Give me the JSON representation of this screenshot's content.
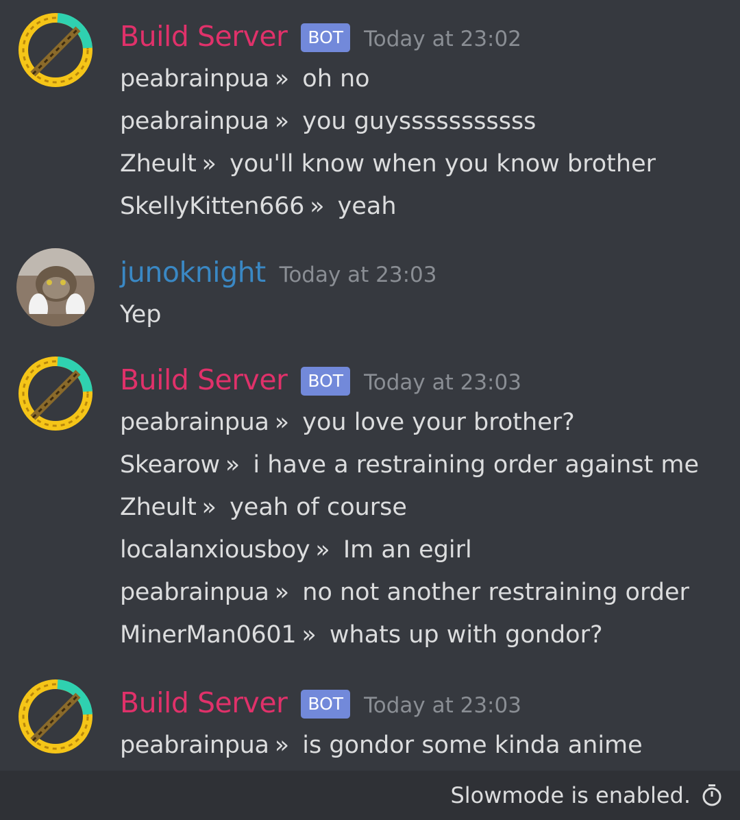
{
  "messages": [
    {
      "author": "Build Server",
      "bot_tag": "BOT",
      "timestamp": "Today at 23:02",
      "lines": [
        {
          "sender": "peabrainpua",
          "sep": "»",
          "text": "oh no"
        },
        {
          "sender": "peabrainpua",
          "sep": "»",
          "text": "you guysssssssssss"
        },
        {
          "sender": "Zheult",
          "sep": "»",
          "text": "you'll know when you know brother"
        },
        {
          "sender": "SkellyKitten666",
          "sep": "»",
          "text": "yeah"
        }
      ]
    },
    {
      "author": "junoknight",
      "timestamp": "Today at 23:03",
      "text": "Yep"
    },
    {
      "author": "Build Server",
      "bot_tag": "BOT",
      "timestamp": "Today at 23:03",
      "lines": [
        {
          "sender": "peabrainpua",
          "sep": "»",
          "text": "you love your brother?"
        },
        {
          "sender": "Skearow",
          "sep": "»",
          "text": "i have a restraining order against me"
        },
        {
          "sender": "Zheult",
          "sep": "»",
          "text": "yeah of course"
        },
        {
          "sender": "localanxiousboy",
          "sep": "»",
          "text": "Im an egirl"
        },
        {
          "sender": "peabrainpua",
          "sep": "»",
          "text": "no not another restraining order"
        },
        {
          "sender": "MinerMan0601",
          "sep": "»",
          "text": "whats up with gondor?"
        }
      ]
    },
    {
      "author": "Build Server",
      "bot_tag": "BOT",
      "timestamp": "Today at 23:03",
      "lines": [
        {
          "sender": "peabrainpua",
          "sep": "»",
          "text": "is gondor some kinda anime"
        }
      ]
    }
  ],
  "footer": {
    "slowmode_text": "Slowmode is enabled.",
    "icon": "stopwatch-icon"
  },
  "colors": {
    "background": "#36393f",
    "footer_background": "#2f3136",
    "bot_author": "#e0316a",
    "user_author": "#3a88c4",
    "bot_tag": "#7289da",
    "timestamp": "#8a8e94",
    "text": "#dcddde"
  }
}
